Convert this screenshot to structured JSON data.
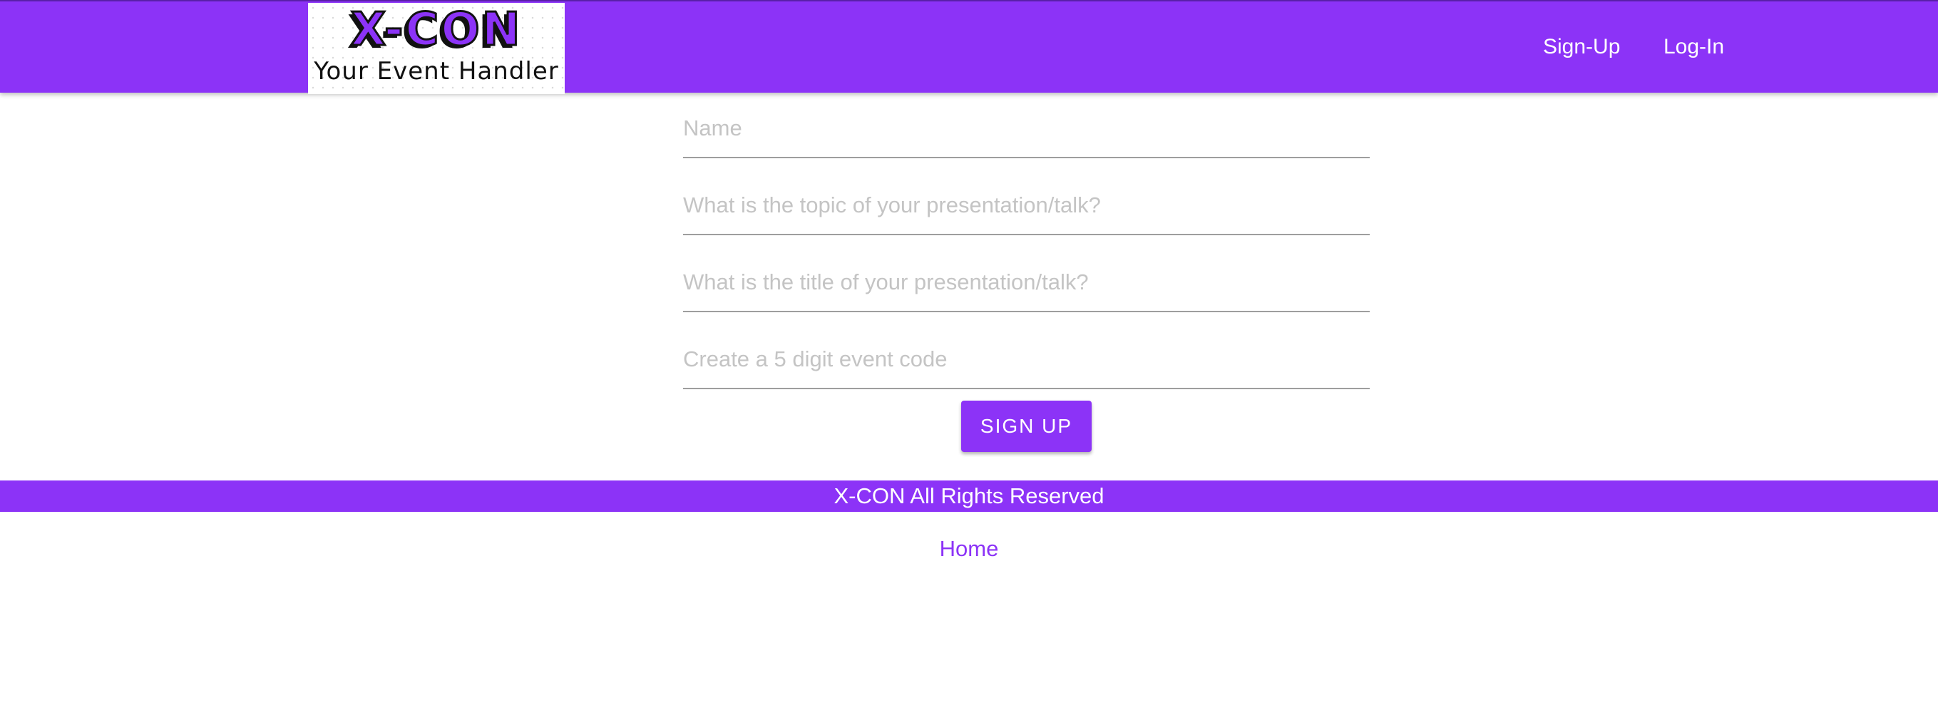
{
  "header": {
    "logo": {
      "title": "X-CON",
      "subtitle": "Your Event Handler"
    },
    "nav": {
      "signup": "Sign-Up",
      "login": "Log-In"
    }
  },
  "form": {
    "name": {
      "placeholder": "Name",
      "value": ""
    },
    "topic": {
      "placeholder": "What is the topic of your presentation/talk?",
      "value": ""
    },
    "title": {
      "placeholder": "What is the title of your presentation/talk?",
      "value": ""
    },
    "event_code": {
      "placeholder": "Create a 5 digit event code",
      "value": ""
    },
    "submit_label": "SIGN UP"
  },
  "footer": {
    "text": "X-CON All Rights Reserved",
    "home_link": "Home"
  },
  "colors": {
    "brand": "#8c33f7",
    "text_on_brand": "#ffffff",
    "placeholder": "#c4c4c4",
    "underline": "#9e9e9e"
  }
}
